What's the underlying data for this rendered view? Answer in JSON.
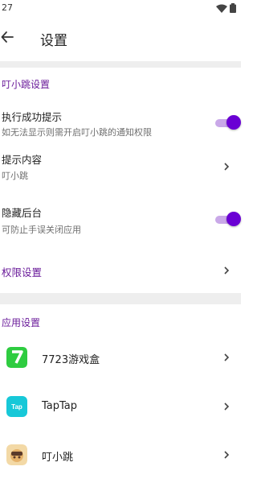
{
  "status_bar": {
    "time": "27"
  },
  "app_bar": {
    "title": "设置"
  },
  "section1": {
    "header": "叮小跳设置",
    "exec_hint": {
      "title": "执行成功提示",
      "subtitle": "如无法显示则需开启叮小跳的通知权限",
      "enabled": true
    },
    "hint_content": {
      "title": "提示内容",
      "value": "叮小跳"
    },
    "hide_bg": {
      "title": "隐藏后台",
      "subtitle": "可防止手误关闭应用",
      "enabled": true
    },
    "permissions": {
      "label": "权限设置"
    }
  },
  "section2": {
    "header": "应用设置",
    "apps": [
      {
        "label": "7723游戏盒",
        "icon": "7723-app-icon"
      },
      {
        "label": "TapTap",
        "icon": "taptap-app-icon",
        "icon_text": "Tap"
      },
      {
        "label": "叮小跳",
        "icon": "dingxiaotiao-app-icon"
      }
    ]
  },
  "colors": {
    "accent": "#6a1b9a",
    "toggle_thumb": "#6a00d4",
    "toggle_track": "#c9a8e8",
    "divider": "#eeeeee"
  }
}
